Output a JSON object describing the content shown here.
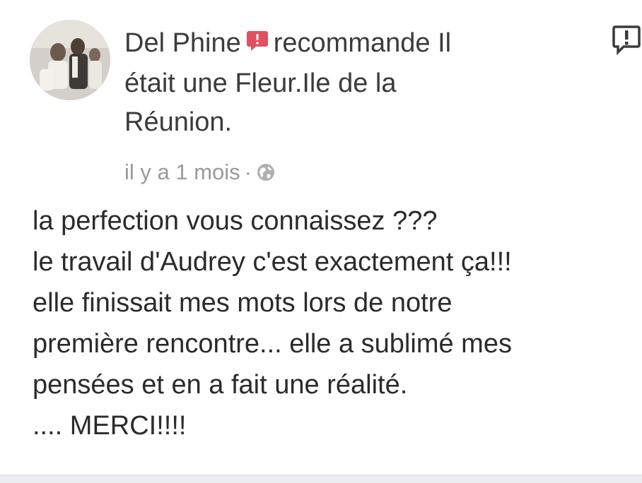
{
  "post": {
    "author": "Del Phine",
    "action_line1": "recommande Il",
    "action_line2": "était une Fleur.Ile de la",
    "action_line3": "Réunion.",
    "timestamp": "il y a 1 mois",
    "separator": "·",
    "privacy_icon": "globe-icon",
    "recommend_icon": "recommend-speech-bubble-icon",
    "report_icon": "report-flag-icon",
    "body_lines": [
      "la perfection vous connaissez ???",
      "le travail d'Audrey c'est exactement ça!!!",
      "elle finissait mes mots lors de notre",
      "première rencontre... elle a sublimé mes",
      "pensées et en a fait une réalité.",
      ".... MERCI!!!!"
    ]
  },
  "colors": {
    "recommend_red": "#e0515f",
    "meta_gray": "#9a9a9a",
    "text_dark": "#2b2b2b"
  }
}
